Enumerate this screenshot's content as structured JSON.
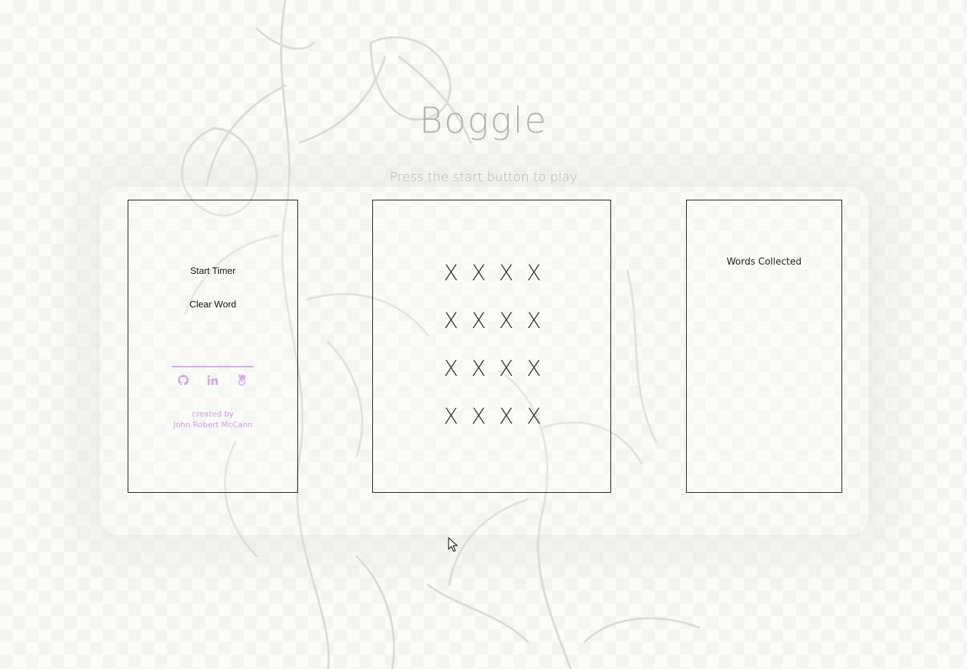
{
  "app": {
    "title": "Boggle",
    "subtitle": "Press the start button to play"
  },
  "controls": {
    "start_label": "Start Timer",
    "clear_label": "Clear Word"
  },
  "social": {
    "icons": [
      "github-icon",
      "linkedin-icon",
      "angellist-icon"
    ],
    "accent_color": "#cfa8e6"
  },
  "credit": {
    "line1": "created by",
    "line2": "John Robert McCann"
  },
  "board": {
    "tiles": [
      "X",
      "X",
      "X",
      "X",
      "X",
      "X",
      "X",
      "X",
      "X",
      "X",
      "X",
      "X",
      "X",
      "X",
      "X",
      "X"
    ]
  },
  "words": {
    "title": "Words Collected",
    "items": []
  }
}
